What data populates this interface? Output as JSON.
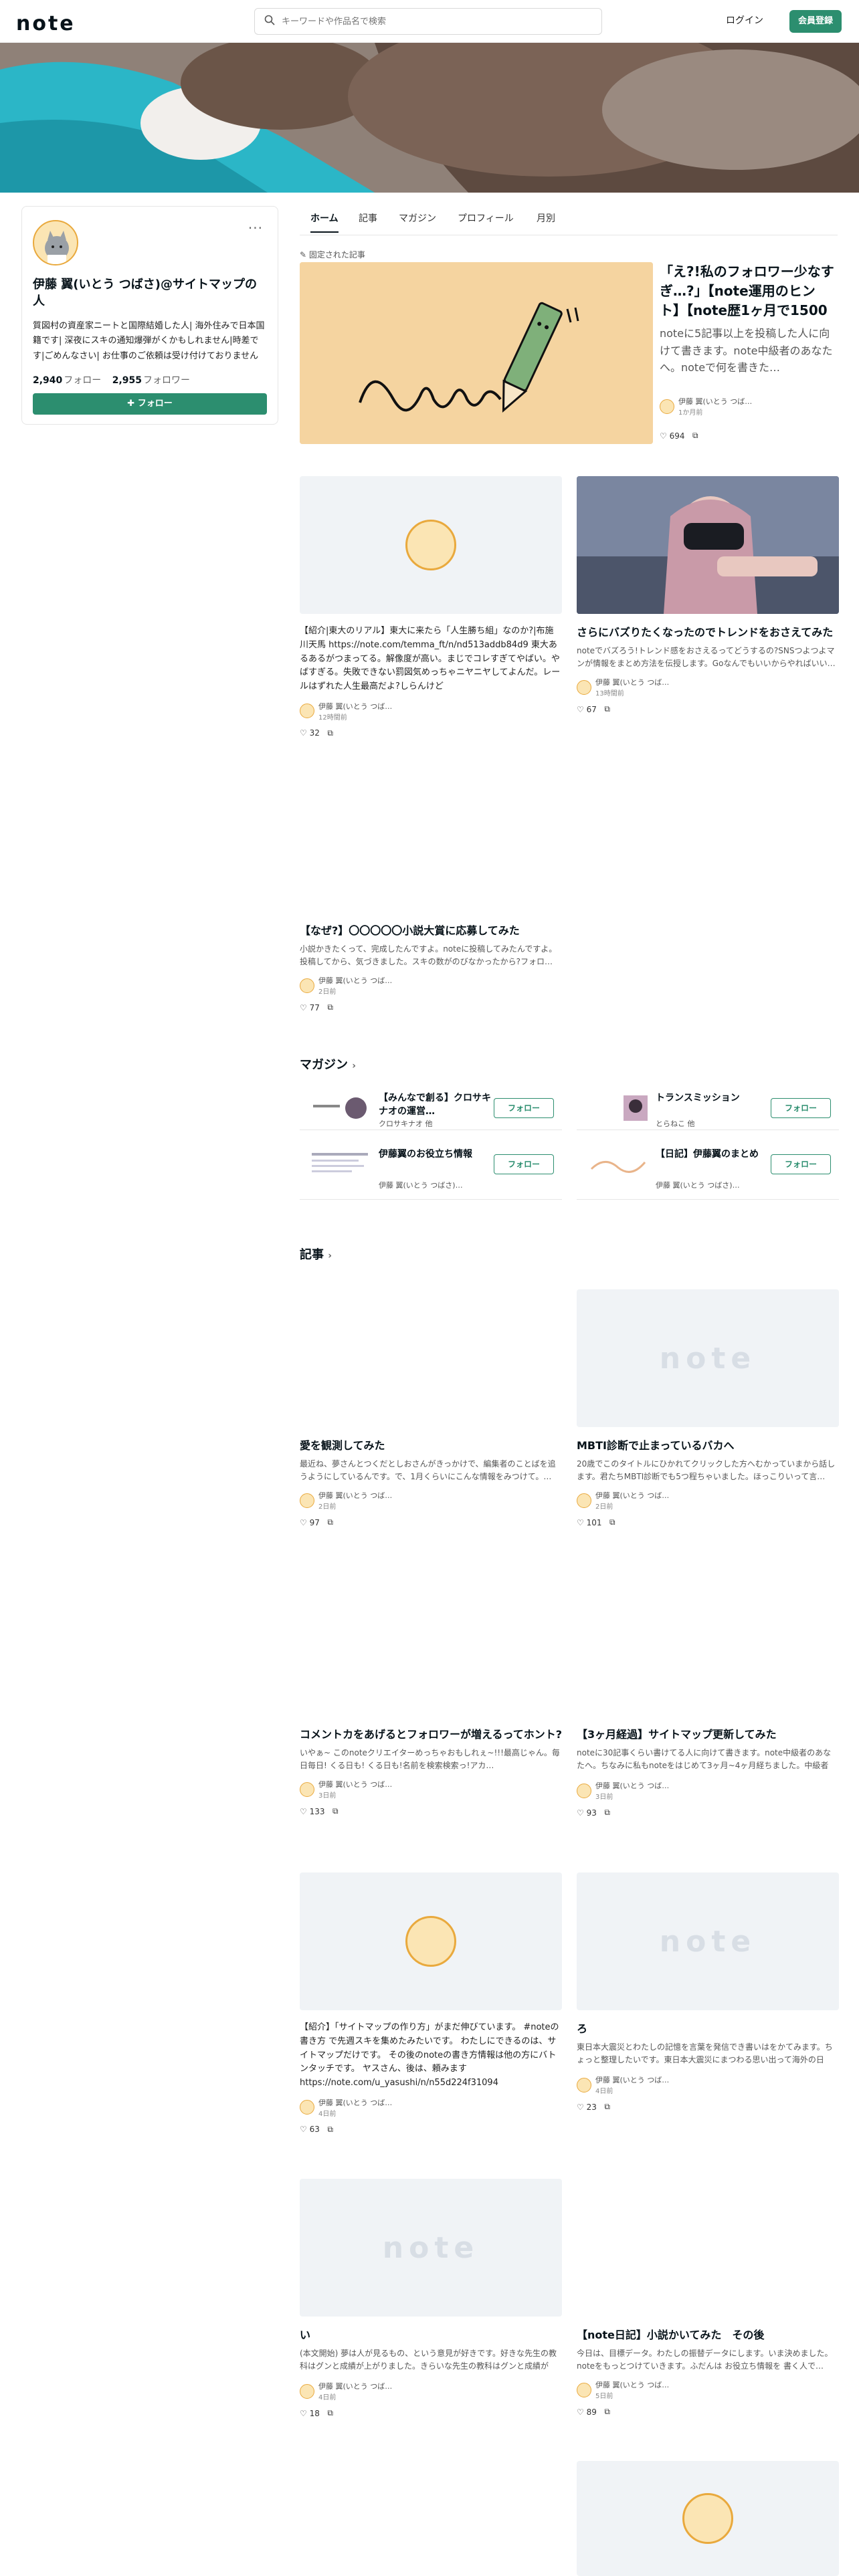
{
  "header": {
    "logo": "note",
    "search_placeholder": "キーワードや作品名で検索",
    "login": "ログイン",
    "signup": "会員登録"
  },
  "profile": {
    "name": "伊藤 翼(いとう つばさ)@サイトマップの人",
    "bio": "質図村の資産家ニートと国際結婚した人| 海外住みで日本国籍です| 深夜にスキの通知爆弾がくかもしれません|時差です|ごめんなさい| お仕事のご依頼は受け付けておりません",
    "following": "2,940",
    "following_label": "フォロー",
    "followers": "2,955",
    "followers_label": "フォロワー",
    "follow_button": "フォロー",
    "more": "···"
  },
  "tabs": [
    "ホーム",
    "記事",
    "マガジン",
    "プロフィール",
    "月別"
  ],
  "pinned": {
    "label": "固定された記事",
    "title": "「え?!私のフォロワー少なすぎ…?」【note運用のヒント】【note歴1ヶ月で1500フォ…",
    "excerpt": "noteに5記事以上を投稿した人に向けて書きます。note中級者のあなたへ。noteで何を書きた…",
    "author": "伊藤 翼(いとう つば…",
    "time": "1か月前",
    "likes": "694"
  },
  "cards_top": [
    {
      "long": "【紹介|東大のリアル】東大に来たら「人生勝ち組」なのか?|布施川天馬 https://note.com/temma_ft/n/nd513addb84d9 東大あるあるがつまってる。解像度が高い。まじでコレすぎてやばい。やばすぎる。失敗できない罰図気めっちゃニヤニヤしてよんだ。レールはずれた人生最高だよ?しらんけど",
      "author": "伊藤 翼(いとう つば…",
      "time": "12時間前",
      "likes": "32"
    },
    {
      "title": "さらにバズりたくなったのでトレンドをおさえてみた",
      "excerpt": "noteでバズろう!トレンド感をおさえるってどうするの?SNSつよつよマンが情報をまとめ方法を伝授します。Goなんでもいいからやればいい…",
      "author": "伊藤 翼(いとう つば…",
      "time": "13時間前",
      "likes": "67"
    },
    {
      "title": "【なぜ?】〇〇〇〇〇小説大賞に応募してみた",
      "excerpt": "小説かきたくって、完成したんですよ。noteに投稿してみたんですよ。投稿してから、気づきました。スキの数がのびなかったから?フォロ…",
      "author": "伊藤 翼(いとう つば…",
      "time": "2日前",
      "likes": "77"
    }
  ],
  "magazines_heading": "マガジン",
  "magazines": [
    {
      "title": "【みんなで創る】クロサキナオの運営…",
      "author": "クロサキナオ 他",
      "follow": "フォロー"
    },
    {
      "title": "トランスミッション",
      "author": "とらねこ 他",
      "follow": "フォロー"
    },
    {
      "title": "伊藤翼のお役立ち情報",
      "author": "伊藤 翼(いとう つばさ)…",
      "follow": "フォロー"
    },
    {
      "title": "【日記】伊藤翼のまとめ",
      "author": "伊藤 翼(いとう つばさ)…",
      "follow": "フォロー"
    }
  ],
  "articles_heading": "記事",
  "articles": [
    {
      "title": "愛を観測してみた",
      "excerpt": "最近ね、夢さんとつくだとしおさんがきっかけで、編集者のことばを追うようにしているんです。で、1月くらいにこんな情報をみつけて。…",
      "author": "伊藤 翼(いとう つば…",
      "time": "2日前",
      "likes": "97"
    },
    {
      "title": "MBTI診断で止まっているバカへ",
      "excerpt": "20歳でこのタイトルにひかれてクリックした方へむかっていまから話します。君たちMBTI診断でも5つ程ちゃいました。ほっこりいって言…",
      "author": "伊藤 翼(いとう つば…",
      "time": "2日前",
      "likes": "101"
    },
    {
      "title": "コメントカをあげるとフォロワーが増えるってホント?",
      "excerpt": "いやぁ~ このnoteクリエイターめっちゃおもしれぇ~!!!最高じゃん。毎日毎日! くる日も! くる日も!名前を検索検索っ!アカ…",
      "author": "伊藤 翼(いとう つば…",
      "time": "3日前",
      "likes": "133"
    },
    {
      "title": "【3ヶ月経過】サイトマップ更新してみた",
      "excerpt": "noteに30記事くらい書けてる人に向けて書きます。note中級者のあなたへ。ちなみに私もnoteをはじめて3ヶ月~4ヶ月経ちました。中級者向…",
      "author": "伊藤 翼(いとう つば…",
      "time": "3日前",
      "likes": "93"
    },
    {
      "long": "【紹介】「サイトマップの作り方」がまだ伸びています。 #noteの書き方 で先週スキを集めたみたいです。 わたしにできるのは、サイトマップだけです。 その後のnoteの書き方情報は他の方にバトンタッチです。 ヤスさん、後は、頼みます https://note.com/u_yasushi/n/n55d224f31094",
      "author": "伊藤 翼(いとう つば…",
      "time": "4日前",
      "likes": "63"
    },
    {
      "title": "ろ",
      "excerpt": "東日本大震災とわたしの記憶を言葉を発信でき書いはをかてみます。ちょっと整理したいです。東日本大震災にまつわる思い出って海外の日本…",
      "author": "伊藤 翼(いとう つば…",
      "time": "4日前",
      "likes": "23"
    },
    {
      "title": "い",
      "excerpt": "(本文開始) 夢は人が見るもの、という意見が好きです。好きな先生の教科はグンと成績が上がりました。きらいな先生の教科はグンと成績が下…",
      "author": "伊藤 翼(いとう つば…",
      "time": "4日前",
      "likes": "18"
    },
    {
      "title": "【note日記】小説かいてみた　その後",
      "excerpt": "今日は、目標データ。わたしの振替データにします。いま決めました。noteをもっとつけていきます。ふだんは お役立ち情報を 書く人で…",
      "author": "伊藤 翼(いとう つば…",
      "time": "5日前",
      "likes": "89"
    }
  ],
  "colors": {
    "accent": "#2c8e6f",
    "text": "#08131a",
    "muted": "#555555"
  }
}
